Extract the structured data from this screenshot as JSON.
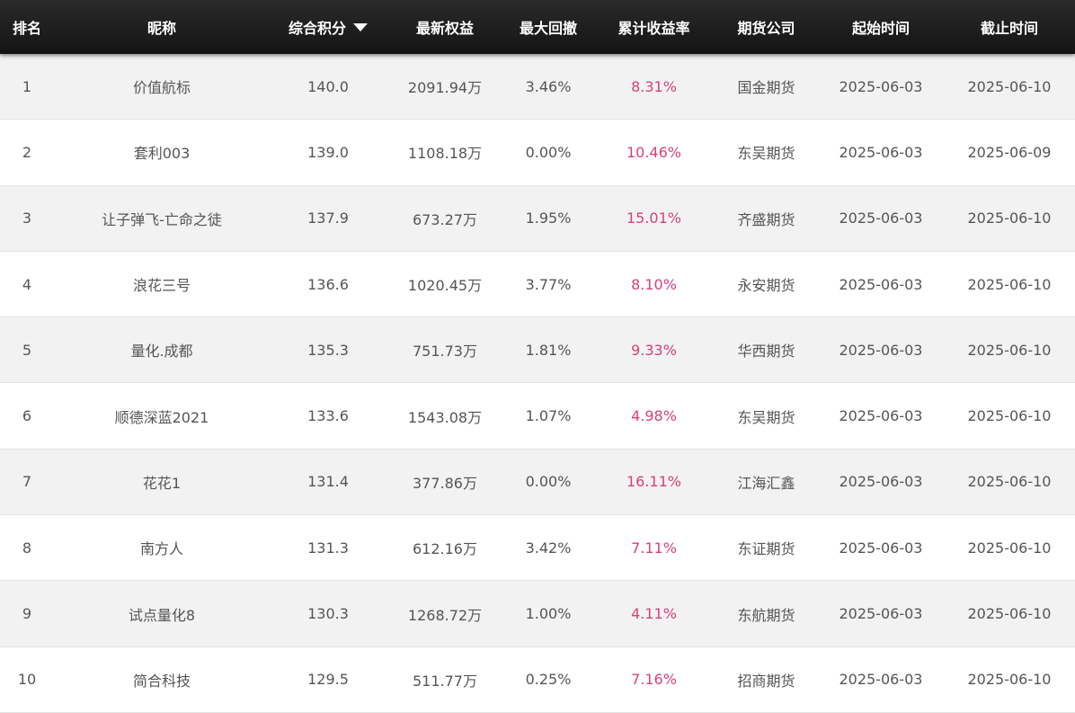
{
  "columns": {
    "rank": "排名",
    "nickname": "昵称",
    "score": "综合积分",
    "equity": "最新权益",
    "max_drawdown": "最大回撤",
    "cumulative_return": "累计收益率",
    "futures_company": "期货公司",
    "start_date": "起始时间",
    "end_date": "截止时间"
  },
  "sort": {
    "column": "score",
    "direction": "desc",
    "icon": "sort-down-icon"
  },
  "colors": {
    "header_bg": "#1a1a1a",
    "return_text": "#d9407a",
    "row_alt": "#f2f2f2"
  },
  "rows": [
    {
      "rank": "1",
      "nickname": "价值航标",
      "score": "140.0",
      "equity": "2091.94万",
      "max_drawdown": "3.46%",
      "cumulative_return": "8.31%",
      "futures_company": "国金期货",
      "start_date": "2025-06-03",
      "end_date": "2025-06-10"
    },
    {
      "rank": "2",
      "nickname": "套利003",
      "score": "139.0",
      "equity": "1108.18万",
      "max_drawdown": "0.00%",
      "cumulative_return": "10.46%",
      "futures_company": "东吴期货",
      "start_date": "2025-06-03",
      "end_date": "2025-06-09"
    },
    {
      "rank": "3",
      "nickname": "让子弹飞-亡命之徒",
      "score": "137.9",
      "equity": "673.27万",
      "max_drawdown": "1.95%",
      "cumulative_return": "15.01%",
      "futures_company": "齐盛期货",
      "start_date": "2025-06-03",
      "end_date": "2025-06-10"
    },
    {
      "rank": "4",
      "nickname": "浪花三号",
      "score": "136.6",
      "equity": "1020.45万",
      "max_drawdown": "3.77%",
      "cumulative_return": "8.10%",
      "futures_company": "永安期货",
      "start_date": "2025-06-03",
      "end_date": "2025-06-10"
    },
    {
      "rank": "5",
      "nickname": "量化.成都",
      "score": "135.3",
      "equity": "751.73万",
      "max_drawdown": "1.81%",
      "cumulative_return": "9.33%",
      "futures_company": "华西期货",
      "start_date": "2025-06-03",
      "end_date": "2025-06-10"
    },
    {
      "rank": "6",
      "nickname": "顺德深蓝2021",
      "score": "133.6",
      "equity": "1543.08万",
      "max_drawdown": "1.07%",
      "cumulative_return": "4.98%",
      "futures_company": "东吴期货",
      "start_date": "2025-06-03",
      "end_date": "2025-06-10"
    },
    {
      "rank": "7",
      "nickname": "花花1",
      "score": "131.4",
      "equity": "377.86万",
      "max_drawdown": "0.00%",
      "cumulative_return": "16.11%",
      "futures_company": "江海汇鑫",
      "start_date": "2025-06-03",
      "end_date": "2025-06-10"
    },
    {
      "rank": "8",
      "nickname": "南方人",
      "score": "131.3",
      "equity": "612.16万",
      "max_drawdown": "3.42%",
      "cumulative_return": "7.11%",
      "futures_company": "东证期货",
      "start_date": "2025-06-03",
      "end_date": "2025-06-10"
    },
    {
      "rank": "9",
      "nickname": "试点量化8",
      "score": "130.3",
      "equity": "1268.72万",
      "max_drawdown": "1.00%",
      "cumulative_return": "4.11%",
      "futures_company": "东航期货",
      "start_date": "2025-06-03",
      "end_date": "2025-06-10"
    },
    {
      "rank": "10",
      "nickname": "简合科技",
      "score": "129.5",
      "equity": "511.77万",
      "max_drawdown": "0.25%",
      "cumulative_return": "7.16%",
      "futures_company": "招商期货",
      "start_date": "2025-06-03",
      "end_date": "2025-06-10"
    }
  ]
}
